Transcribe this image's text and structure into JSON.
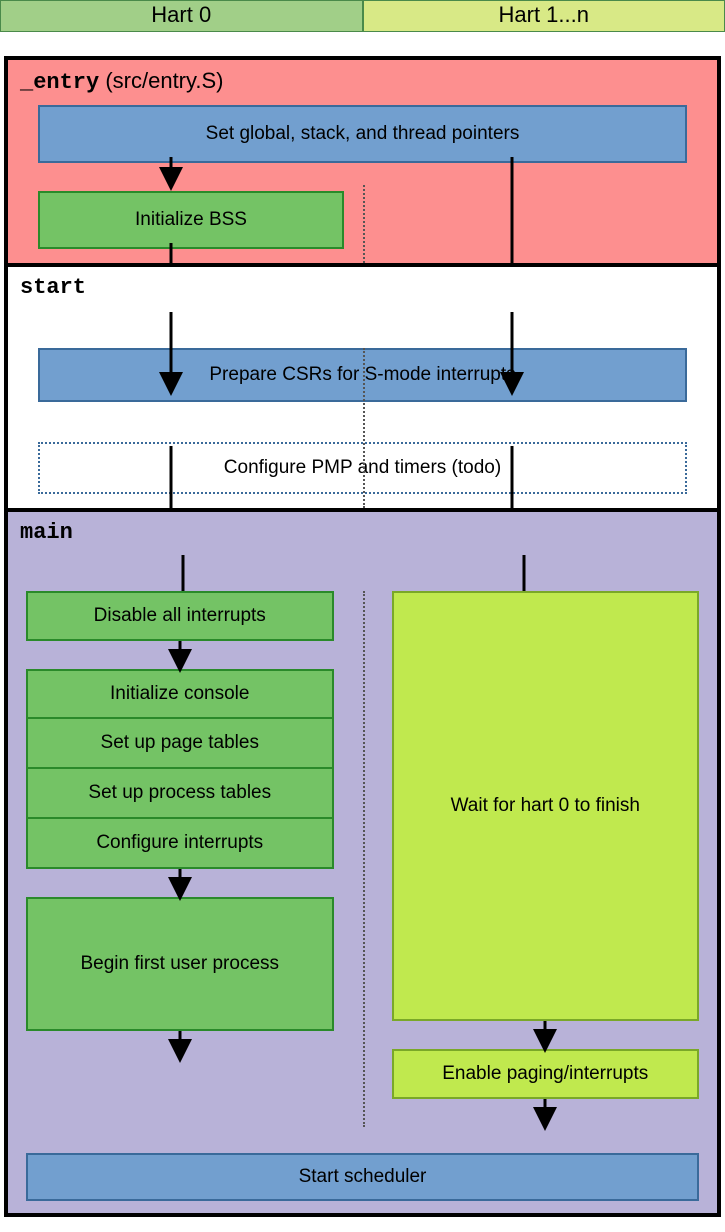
{
  "header": {
    "hart0": "Hart 0",
    "hart1n": "Hart 1...n"
  },
  "sections": {
    "entry": {
      "title_code": "_entry",
      "title_rest": " (src/entry.S)",
      "set_pointers": "Set global, stack, and thread pointers",
      "init_bss": "Initialize BSS"
    },
    "start": {
      "title": "start",
      "prepare_csrs": "Prepare CSRs for S-mode interrupts",
      "configure_pmp": "Configure PMP and timers (todo)"
    },
    "main": {
      "title": "main",
      "disable_interrupts": "Disable all interrupts",
      "init_console": "Initialize console",
      "page_tables": "Set up page tables",
      "process_tables": "Set up process tables",
      "config_interrupts": "Configure interrupts",
      "first_user_process": "Begin first user process",
      "wait_hart0": "Wait for hart 0 to finish",
      "enable_paging": "Enable paging/interrupts",
      "start_scheduler": "Start scheduler"
    }
  }
}
